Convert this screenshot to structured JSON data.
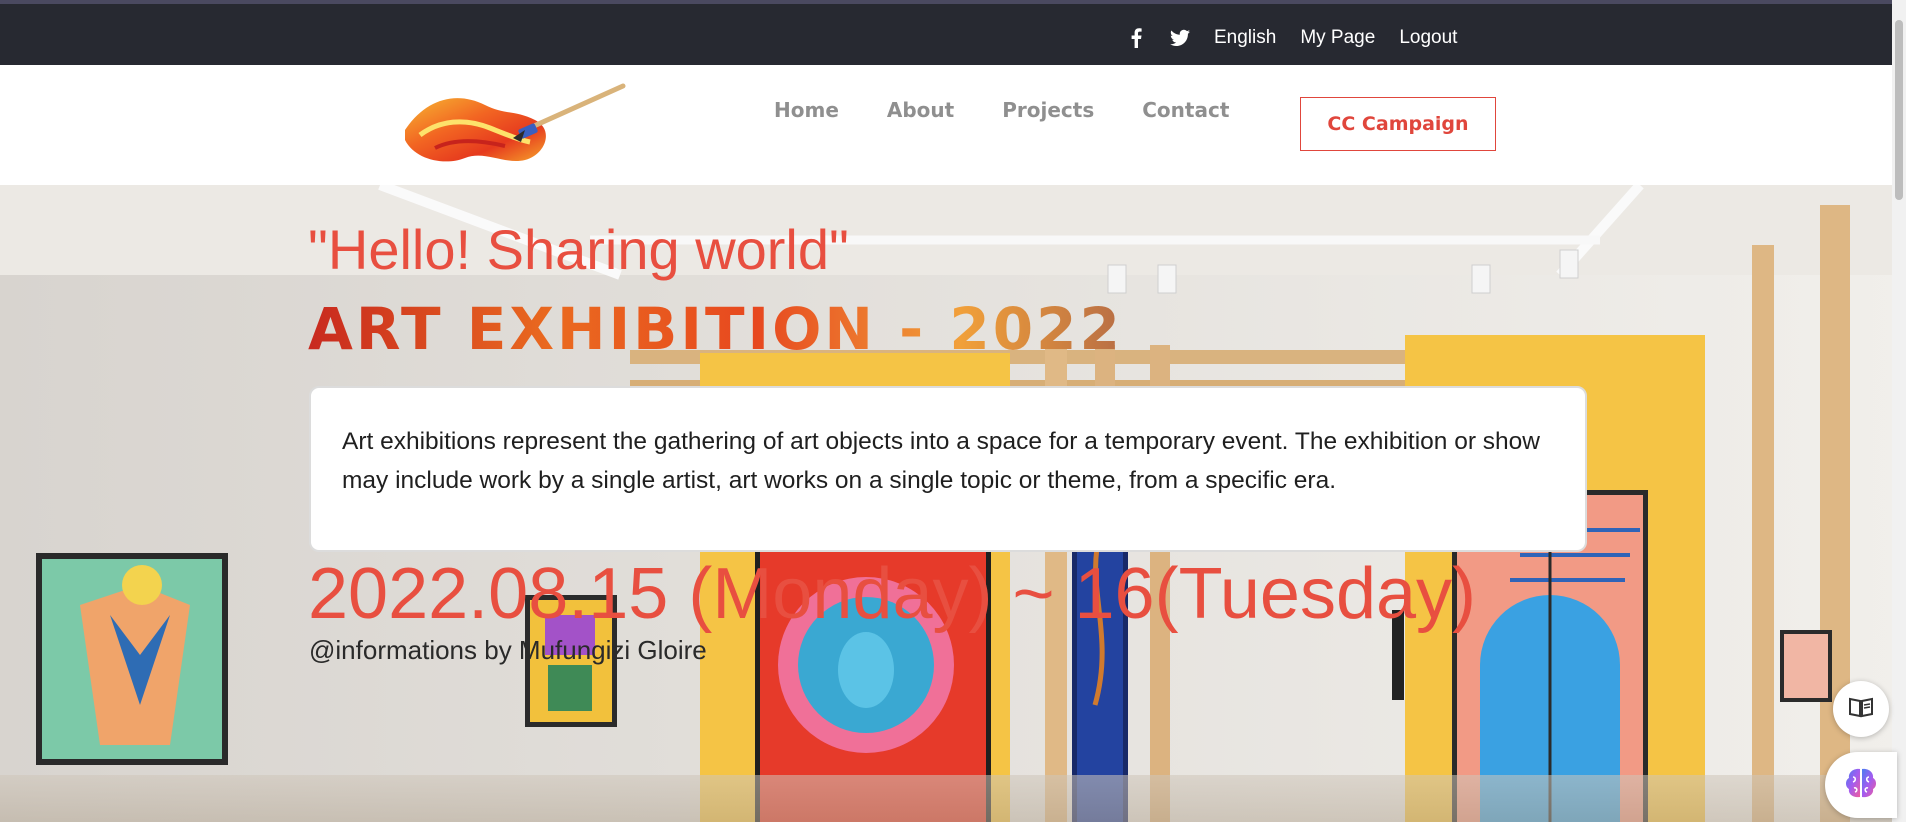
{
  "topbar": {
    "facebook_icon": "facebook-icon",
    "twitter_icon": "twitter-icon",
    "language": "English",
    "my_page": "My Page",
    "logout": "Logout"
  },
  "nav": {
    "items": [
      "Home",
      "About",
      "Projects",
      "Contact"
    ],
    "cta": "CC Campaign"
  },
  "hero": {
    "title": "\"Hello! Sharing world\"",
    "subtitle": "ART EXHIBITION - 2022",
    "description": "Art exhibitions represent the gathering of art objects into a space for a temporary event. The exhibition or show may include work by a single artist, art works on a single topic or theme, from a specific era.",
    "date": "2022.08.15 (Monday) ~ 16(Tuesday)",
    "credit": "@informations by Mufungizi Gloire"
  },
  "colors": {
    "topbar_bg": "#272931",
    "accent": "#e84f40",
    "nav_text": "#8f8f8f"
  },
  "floating": {
    "reader_icon": "book-icon",
    "assistant_icon": "brain-icon"
  }
}
